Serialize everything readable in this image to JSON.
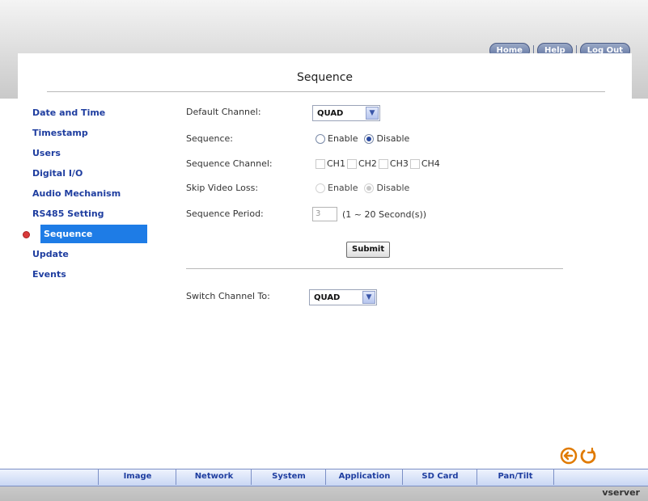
{
  "top_nav": {
    "home_label": "Home",
    "help_label": "Help",
    "logout_label": "Log Out"
  },
  "page": {
    "title": "Sequence"
  },
  "sidebar": {
    "items": [
      {
        "label": "Date and Time"
      },
      {
        "label": "Timestamp"
      },
      {
        "label": "Users"
      },
      {
        "label": "Digital I/O"
      },
      {
        "label": "Audio Mechanism"
      },
      {
        "label": "RS485 Setting"
      },
      {
        "label": "Sequence"
      },
      {
        "label": "Update"
      },
      {
        "label": "Events"
      }
    ],
    "active_index": 6
  },
  "form": {
    "default_channel": {
      "label": "Default Channel:",
      "value": "QUAD"
    },
    "sequence": {
      "label": "Sequence:",
      "enable_label": "Enable",
      "disable_label": "Disable",
      "selected": "Disable"
    },
    "sequence_channel": {
      "label": "Sequence Channel:",
      "options": [
        "CH1",
        "CH2",
        "CH3",
        "CH4"
      ]
    },
    "skip_video_loss": {
      "label": "Skip Video Loss:",
      "enable_label": "Enable",
      "disable_label": "Disable",
      "selected": "Disable"
    },
    "sequence_period": {
      "label": "Sequence Period:",
      "value": "3",
      "hint": "(1 ~ 20 Second(s))"
    },
    "submit_label": "Submit",
    "switch_channel": {
      "label": "Switch Channel To:",
      "value": "QUAD"
    }
  },
  "bottom_tabs": [
    {
      "label": "Image"
    },
    {
      "label": "Network"
    },
    {
      "label": "System"
    },
    {
      "label": "Application"
    },
    {
      "label": "SD Card"
    },
    {
      "label": "Pan/Tilt"
    }
  ],
  "brand": "vserver",
  "colors": {
    "accent": "#1e7ce6",
    "link": "#1f3ea0",
    "back_icon": "#e07a00"
  }
}
